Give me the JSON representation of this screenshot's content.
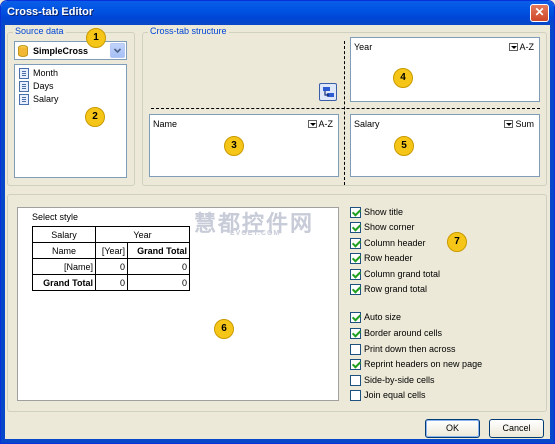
{
  "window": {
    "title": "Cross-tab Editor",
    "close_glyph": "✕"
  },
  "source_data": {
    "title": "Source data",
    "combo_value": "SimpleCross",
    "fields": [
      {
        "label": "Month"
      },
      {
        "label": "Days"
      },
      {
        "label": "Salary"
      }
    ]
  },
  "structure": {
    "title": "Cross-tab structure",
    "column_field": {
      "label": "Year",
      "sort": "A-Z"
    },
    "row_field": {
      "label": "Name",
      "sort": "A-Z"
    },
    "data_field": {
      "label": "Salary",
      "sort": "Sum"
    }
  },
  "badges": [
    "1",
    "2",
    "3",
    "4",
    "5",
    "6",
    "7"
  ],
  "preview": {
    "select_style_label": "Select style",
    "table": {
      "r0": [
        "Salary",
        "Year"
      ],
      "r1": [
        "Name",
        "[Year]",
        "Grand Total"
      ],
      "r2": [
        "[Name]",
        "0",
        "0"
      ],
      "r3": [
        "Grand Total",
        "0",
        "0"
      ]
    }
  },
  "options_group1": [
    {
      "label": "Show title",
      "checked": true
    },
    {
      "label": "Show corner",
      "checked": true
    },
    {
      "label": "Column header",
      "checked": true
    },
    {
      "label": "Row header",
      "checked": true
    },
    {
      "label": "Column grand total",
      "checked": true
    },
    {
      "label": "Row grand total",
      "checked": true
    }
  ],
  "options_group2": [
    {
      "label": "Auto size",
      "checked": true
    },
    {
      "label": "Border around cells",
      "checked": true
    },
    {
      "label": "Print down then across",
      "checked": false
    },
    {
      "label": "Reprint headers on new page",
      "checked": true
    },
    {
      "label": "Side-by-side cells",
      "checked": false
    },
    {
      "label": "Join equal cells",
      "checked": false
    }
  ],
  "buttons": {
    "ok": "OK",
    "cancel": "Cancel"
  },
  "watermark": {
    "main": "慧都控件网",
    "sub": "EVGET.COM"
  },
  "colors": {
    "title_bar": "#0053e2",
    "badge": "#f5c518",
    "group_title": "#0046d5",
    "check": "#21a121"
  }
}
